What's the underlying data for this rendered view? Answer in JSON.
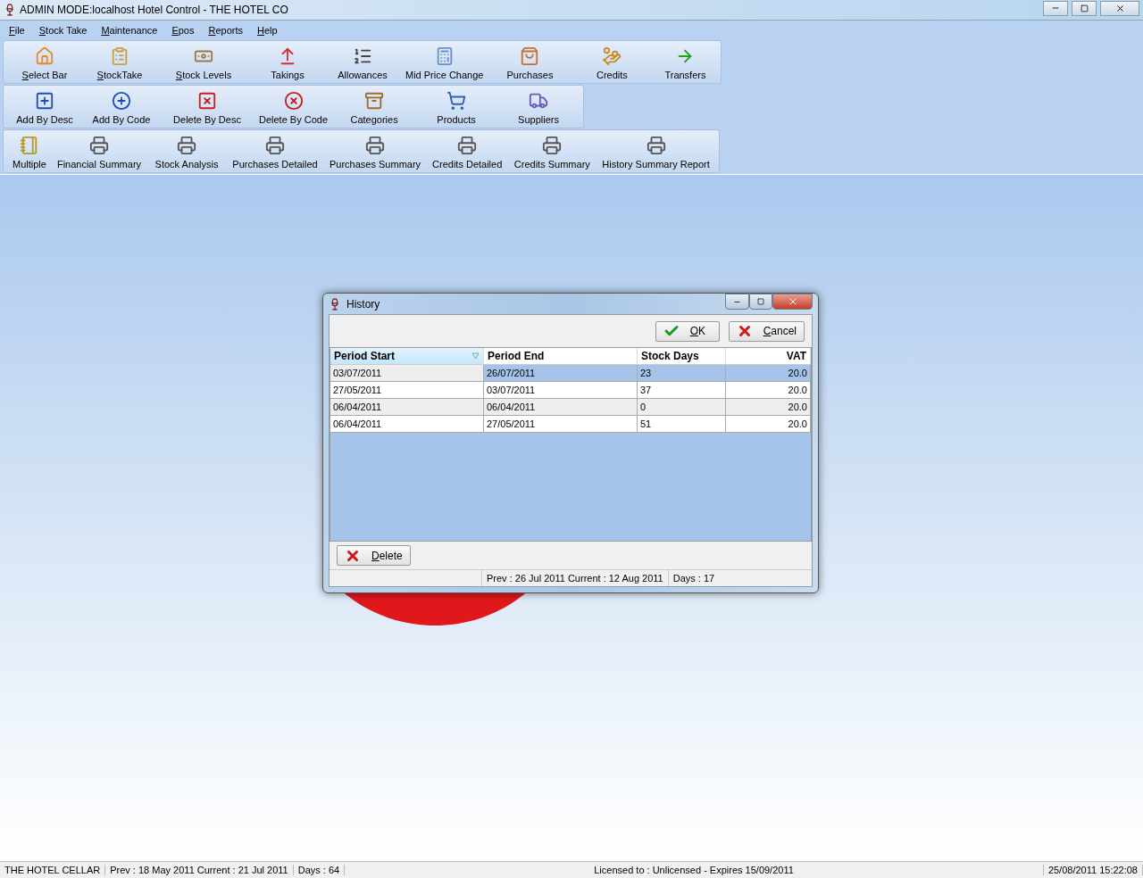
{
  "window": {
    "title": "ADMIN MODE:localhost Hotel Control - THE HOTEL CO"
  },
  "menu": [
    "File",
    "Stock Take",
    "Maintenance",
    "Epos",
    "Reports",
    "Help"
  ],
  "toolbars": [
    [
      {
        "label": "Select Bar",
        "mnemonic": true
      },
      {
        "label": "StockTake",
        "mnemonic": true
      },
      {
        "label": "Stock Levels",
        "mnemonic": true
      },
      {
        "label": "Takings",
        "mnemonic": false
      },
      {
        "label": "Allowances",
        "mnemonic": false
      },
      {
        "label": "Mid Price Change",
        "mnemonic": false
      },
      {
        "label": "Purchases",
        "mnemonic": false
      },
      {
        "label": "Credits",
        "mnemonic": false
      },
      {
        "label": "Transfers",
        "mnemonic": false
      }
    ],
    [
      {
        "label": "Add By Desc",
        "mnemonic": false
      },
      {
        "label": "Add By Code",
        "mnemonic": false
      },
      {
        "label": "Delete By Desc",
        "mnemonic": false
      },
      {
        "label": "Delete By Code",
        "mnemonic": false
      },
      {
        "label": "Categories",
        "mnemonic": false
      },
      {
        "label": "Products",
        "mnemonic": false
      },
      {
        "label": "Suppliers",
        "mnemonic": false
      }
    ],
    [
      {
        "label": "Multiple",
        "mnemonic": false
      },
      {
        "label": "Financial Summary",
        "mnemonic": false
      },
      {
        "label": "Stock Analysis",
        "mnemonic": false
      },
      {
        "label": "Purchases Detailed",
        "mnemonic": false
      },
      {
        "label": "Purchases Summary",
        "mnemonic": false
      },
      {
        "label": "Credits Detailed",
        "mnemonic": false
      },
      {
        "label": "Credits Summary",
        "mnemonic": false
      },
      {
        "label": "History Summary Report",
        "mnemonic": false
      }
    ]
  ],
  "dialog": {
    "title": "History",
    "buttons": [
      "OK",
      "Cancel"
    ],
    "table": {
      "columns": [
        "Period Start",
        "Period End",
        "Stock Days",
        "VAT"
      ],
      "rows": [
        {
          "cells": [
            "03/07/2011",
            "26/07/2011",
            "23",
            "20.0"
          ],
          "selected": true
        },
        {
          "cells": [
            "27/05/2011",
            "03/07/2011",
            "37",
            "20.0"
          ],
          "selected": false
        },
        {
          "cells": [
            "06/04/2011",
            "06/04/2011",
            "0",
            "20.0"
          ],
          "selected": false
        },
        {
          "cells": [
            "06/04/2011",
            "27/05/2011",
            "51",
            "20.0"
          ],
          "selected": false
        }
      ]
    },
    "delete_button": "Delete",
    "status_bar": [
      "Prev : 26 Jul 2011  Current : 12 Aug 2011",
      "Days : 17"
    ]
  },
  "status_bar": [
    "THE HOTEL  CELLAR",
    "Prev : 18 May 2011  Current : 21 Jul 2011",
    "Days : 64",
    "Licensed to : Unlicensed - Expires 15/09/2011",
    "25/08/2011 15:22:08"
  ]
}
